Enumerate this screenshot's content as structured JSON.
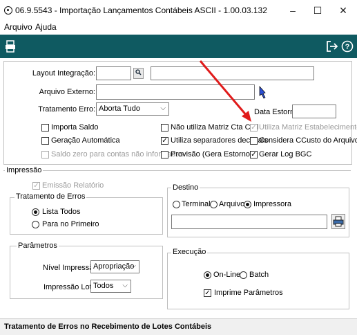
{
  "window": {
    "title": "06.9.5543 - Importação Lançamentos Contábeis ASCII - 1.00.03.132",
    "minimize": "–",
    "maximize": "☐",
    "close": "✕"
  },
  "menu": [
    "Arquivo",
    "Ajuda"
  ],
  "toolbar": {
    "colors": {
      "background": "#0f5a61"
    }
  },
  "form": {
    "layout_label": "Layout Integração:",
    "arquivo_label": "Arquivo Externo:",
    "tratamento_label": "Tratamento Erro:",
    "tratamento_value": "Aborta Tudo",
    "data_estorno_label": "Data Estorno:",
    "checks": {
      "importa_saldo": "Importa Saldo",
      "geracao_automatica": "Geração Automática",
      "saldo_zero": "Saldo zero para contas não informadas",
      "nao_utiliza_matriz": "Não utiliza Matriz Cta Ctbl",
      "utiliza_separadores": "Utiliza separadores decimais",
      "provisao": "Provisão (Gera Estorno)",
      "utiliza_matriz_estab": "Utiliza Matriz Estabelecimento",
      "considera_ccusto": "Considera CCusto do Arquivo",
      "gerar_log": "Gerar Log BGC"
    }
  },
  "impressao": {
    "title": "Impressão",
    "emissao_relatorio": "Emissão Relatório",
    "tratamento_title": "Tratamento de Erros",
    "lista_todos": "Lista Todos",
    "para_no_primeiro": "Para no Primeiro",
    "parametros_title": "Parâmetros",
    "nivel_label": "Nível Impressão:",
    "nivel_value": "Apropriação",
    "lotes_label": "Impressão Lotes:",
    "lotes_value": "Todos",
    "destino_title": "Destino",
    "terminal": "Terminal",
    "arquivo": "Arquivo",
    "impressora": "Impressora",
    "execucao_title": "Execução",
    "online": "On-Line",
    "batch": "Batch",
    "imprime_parametros": "Imprime Parâmetros"
  },
  "status": "Tratamento de Erros no Recebimento de Lotes Contábeis"
}
